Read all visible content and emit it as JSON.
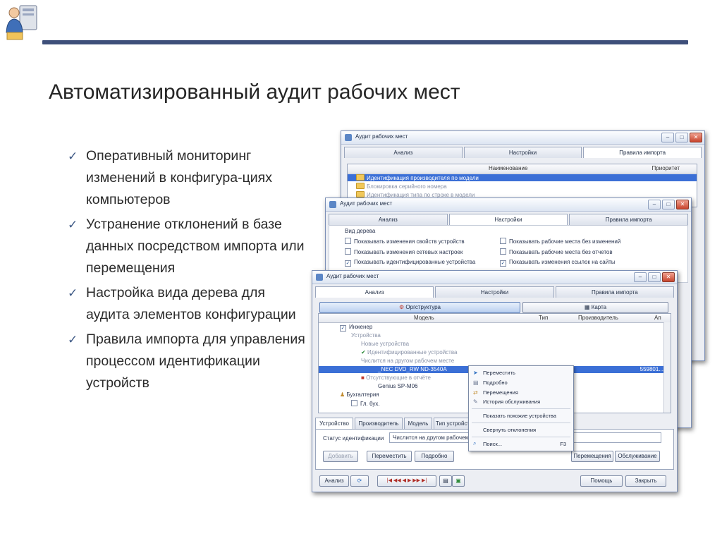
{
  "slide": {
    "title": "Автоматизированный аудит рабочих мест",
    "bullets": [
      "Оперативный мониторинг изменений в конфигура-циях компьютеров",
      "Устранение отклонений в базе данных посредством импорта или перемещения",
      "Настройка вида дерева для аудита элементов конфигурации",
      "Правила импорта для управления процессом идентификации устройств"
    ],
    "accent_color": "#3e4f7a"
  },
  "windows": {
    "title": "Аудит рабочих мест",
    "tabs": [
      "Анализ",
      "Настройки",
      "Правила импорта"
    ],
    "back": {
      "header_name": "Наименование",
      "header_priority": "Приоритет",
      "rows": [
        "Идентификация производителя по модели",
        "Блокировка серийного номера",
        "Идентификация типа по строке в модели"
      ]
    },
    "middle": {
      "group_label": "Вид дерева",
      "options_left": [
        "Показывать изменения свойств устройств",
        "Показывать изменения сетевых настроек",
        "Показывать идентифицированные устройства"
      ],
      "options_left_checked": [
        false,
        false,
        true
      ],
      "options_right": [
        "Показывать рабочие места без изменений",
        "Показывать рабочие места без отчетов",
        "Показывать изменения ссылок на сайты"
      ],
      "options_right_checked": [
        false,
        false,
        true
      ]
    },
    "front": {
      "view_buttons": [
        "Оргструктура",
        "Карта"
      ],
      "columns": [
        "Модель",
        "Тип",
        "Производитель",
        "Ап"
      ],
      "tree": [
        "Инженер",
        "Устройства",
        "Новые устройства",
        "Идентифицированные устройства",
        "Числится на другом рабочем месте",
        "_NEC DVD_RW ND-3540A",
        "Отсутствующие в отчёте",
        "Genius SP-M06",
        "Бухгалтерия",
        "Гл. бух."
      ],
      "selected_code": "559801...",
      "detail_tabs": [
        "Устройство",
        "Производитель",
        "Модель",
        "Тип устройст"
      ],
      "status_label": "Статус идентификации",
      "status_value": "Числится на другом рабочем",
      "buttons_left": [
        "Добавить",
        "Переместить",
        "Подробно"
      ],
      "buttons_right": [
        "Перемещения",
        "Обслуживание"
      ],
      "footer_left": "Анализ",
      "nav_glyphs": "|◀  ◀◀  ◀  ▶  ▶▶  ▶|",
      "footer_right": [
        "Помощь",
        "Закрыть"
      ]
    },
    "context_menu": [
      "Переместить",
      "Подробно",
      "Перемещения",
      "История обслуживания",
      "Показать похожие устройства",
      "Свернуть отклонения",
      "Поиск..."
    ],
    "shortcut": "F3"
  }
}
